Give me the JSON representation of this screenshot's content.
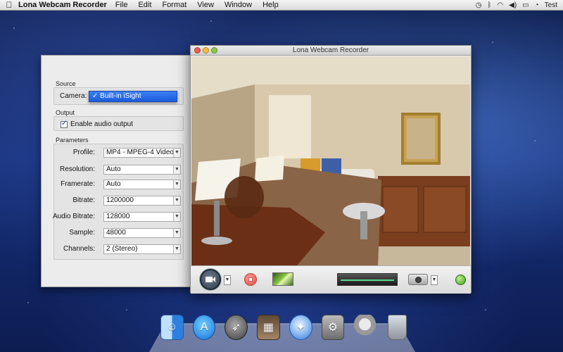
{
  "menubar": {
    "apple_icon": "apple-logo-icon",
    "app_name": "Lona Webcam Recorder",
    "menus": [
      "File",
      "Edit",
      "Format",
      "View",
      "Window",
      "Help"
    ],
    "user": "Test",
    "status_icons": [
      "time-machine-icon",
      "bluetooth-icon",
      "wifi-icon",
      "volume-icon",
      "battery-icon",
      "clock-icon"
    ]
  },
  "panel": {
    "source_label": "Source",
    "camera_label": "Camera:",
    "camera_value": "✓ Built-in iSight",
    "output_label": "Output",
    "enable_audio_label": "Enable audio output",
    "enable_audio_checked": true,
    "parameters_label": "Parameters",
    "params": [
      {
        "label": "Profile:",
        "value": "MP4 - MPEG-4 Video"
      },
      {
        "label": "Resolution:",
        "value": "Auto"
      },
      {
        "label": "Framerate:",
        "value": "Auto"
      },
      {
        "label": "Bitrate:",
        "value": "1200000"
      },
      {
        "label": "Audio Bitrate:",
        "value": "128000"
      },
      {
        "label": "Sample:",
        "value": "48000"
      },
      {
        "label": "Channels:",
        "value": "2 (Stereo)"
      }
    ]
  },
  "recorder": {
    "title": "Lona Webcam Recorder"
  },
  "dock": {
    "apps": [
      "finder-icon",
      "app-store-icon",
      "launchpad-icon",
      "photo-booth-icon",
      "safari-icon",
      "system-preferences-icon",
      "webcam-recorder-icon",
      "trash-icon"
    ]
  },
  "colors": {
    "selection_blue": "#1a5ddd",
    "stop_red": "#e04b44",
    "record_dark": "#2d3a4a"
  }
}
